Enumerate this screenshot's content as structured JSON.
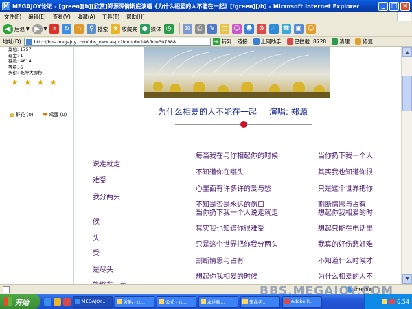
{
  "window": {
    "app_icon": "M",
    "title": "MEGAJOY论坛 - [green][b][欣赏]郑源深情斯底演唱《为什么相爱的人不能在一起》[/green][/b] - Microsoft Internet Explorer",
    "minimize": "_",
    "maximize": "□",
    "close": "×"
  },
  "menu": [
    "文件(F)",
    "编辑(E)",
    "查看(V)",
    "收藏(A)",
    "工具(T)",
    "帮助(H)"
  ],
  "toolbar": {
    "back_label": "后退",
    "search_label": "搜索",
    "favorites_label": "收藏夹",
    "media_label": "媒体"
  },
  "address": {
    "label": "地址(D)",
    "url": "http://bbs.megajoy.com/bbs_view.aspx?fcubid=24&fid=307888",
    "go_label": "转到",
    "links_label": "链接",
    "sync_label": "上网助手",
    "blocked_label": "已拦截: 8728",
    "clean_label": "清理",
    "repair_label": "修复"
  },
  "user": {
    "stats": [
      "发帖: 1757",
      "现金: 1",
      "存款: 4614",
      "等级: 6",
      "头衔: 乾坤大挪移"
    ],
    "stars": [
      "★",
      "★",
      "★",
      "★"
    ],
    "flower_label": "鲜花",
    "flower_count": "(0)",
    "egg_label": "鸡蛋",
    "egg_count": "(0)"
  },
  "post": {
    "song_title": "为什么相爱的人不能在一起",
    "singer": "演唱: 郑源",
    "lyrics_left": [
      "说走就走",
      "难受",
      "我分两头",
      "候",
      "头",
      "受",
      "是尽头",
      "能够在一起"
    ],
    "lyrics_mid": [
      "每当我在与你相起你的时候",
      "不知道你在哪头",
      "心里面有许多许的爱与愁",
      "不知是否是永远的伤口",
      "当你扔下我一个人说走就走",
      "其实我也知道你很难受",
      "只是这个世界把你我分两头",
      "割断情思与占有",
      "想起你我相爱的时候"
    ],
    "lyrics_right": [
      "当你扔下我一个人",
      "其实我也知道你很",
      "只是这个世界把你",
      "割断情思与占有",
      "想起你我相爱的时",
      "想起只能在电话里",
      "我真的好伤悲好难",
      "不知道什么时候才",
      "为什么相爱的人不"
    ]
  },
  "status": {
    "zone_label": "Internet",
    "watermark": "BBS.MEGAJOY.COM"
  },
  "taskbar": {
    "start_label": "开始",
    "tasks": [
      "MEGAJOY...",
      "发贴 - rt...",
      "公式 - rt...",
      "本地磁...",
      "未命名...",
      "Adobe P..."
    ],
    "clock": "6:54"
  }
}
